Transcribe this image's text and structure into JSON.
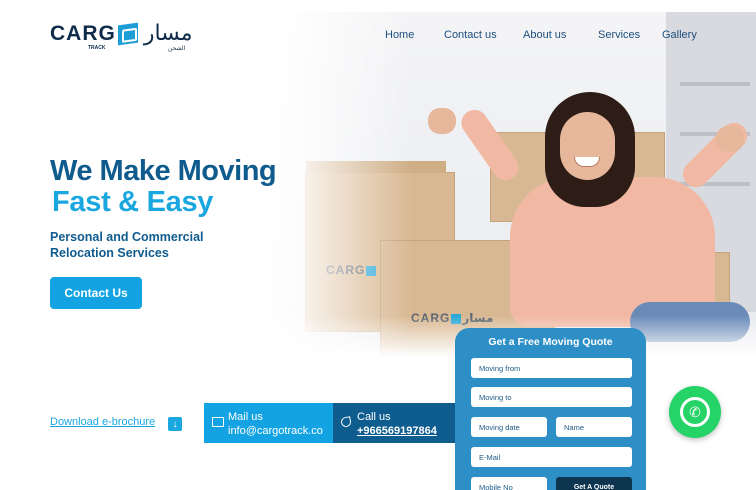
{
  "header": {
    "logo_text": "CARG",
    "logo_arabic": "مسار",
    "logo_sub": "TRACK",
    "logo_sub_ar": "الشحن",
    "nav": [
      {
        "label": "Home"
      },
      {
        "label": "Contact us"
      },
      {
        "label": "About us"
      },
      {
        "label": "Services"
      },
      {
        "label": "Gallery"
      }
    ]
  },
  "hero": {
    "title_line1": "We Make Moving",
    "title_line2": "Fast & Easy",
    "subtitle_line1": "Personal and Commercial",
    "subtitle_line2": "Relocation Services",
    "cta_label": "Contact Us",
    "box_logo_text": "CARG",
    "box_logo_ar": "مسار"
  },
  "brochure": {
    "label": "Download e-brochure",
    "icon": "download-icon"
  },
  "contact_strip": {
    "mail_label": "Mail us",
    "mail_value": "info@cargotrack.co",
    "mail_icon": "mail-icon",
    "call_label": "Call us",
    "call_value": "+966569197864",
    "call_icon": "phone-icon"
  },
  "quote_form": {
    "title": "Get a Free Moving Quote",
    "fields": {
      "moving_from": "Moving from",
      "moving_to": "Moving to",
      "moving_date": "Moving date",
      "name": "Name",
      "email": "E-Mail",
      "mobile": "Mobile No"
    },
    "submit_label": "Get A Quote"
  },
  "whatsapp": {
    "icon": "whatsapp-icon"
  },
  "colors": {
    "primary_dark": "#0f5b8e",
    "primary_light": "#1aa7e0",
    "cta": "#13a3e3",
    "call_bg": "#0e5d8e",
    "form_bg": "#2d8fc6",
    "whatsapp": "#25d366"
  }
}
